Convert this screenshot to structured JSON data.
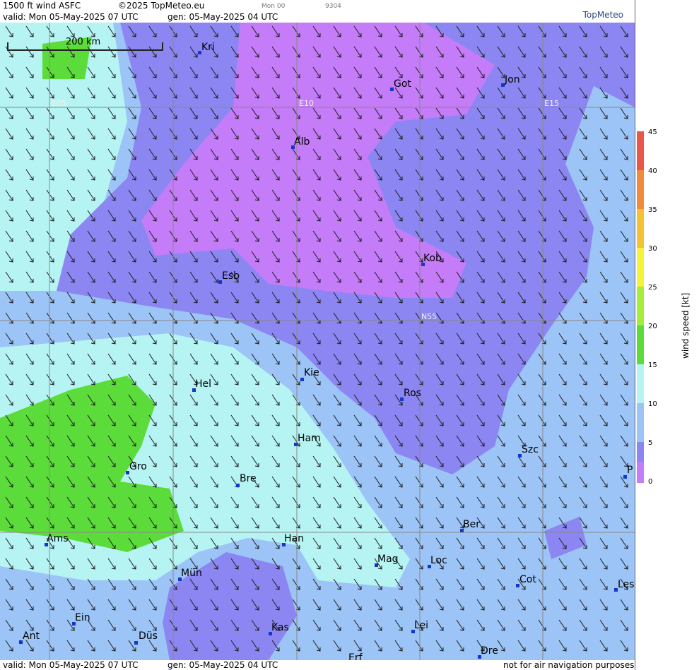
{
  "header": {
    "product": "1500 ft wind ASFC",
    "copyright": "©2025 TopMeteo.eu",
    "valid": "valid:  Mon  05-May-2025  07 UTC",
    "gen": "gen: 05-May-2025 04 UTC",
    "small_a": "Mon 00",
    "small_b": "9304",
    "logo": "TopMeteo"
  },
  "footer": {
    "valid": "valid:  Mon  05-May-2025  07 UTC",
    "gen": "gen: 05-May-2025 04 UTC",
    "note": "not for air navigation purposes"
  },
  "scale": {
    "label": "200 km"
  },
  "grid_labels": [
    "E05",
    "E10",
    "E15",
    "N55"
  ],
  "cities": [
    "Kri",
    "Got",
    "Jon",
    "Alb",
    "Kob",
    "Esb",
    "Kie",
    "Hel",
    "Ros",
    "Ham",
    "Szc",
    "Gro",
    "Bre",
    "P",
    "Ber",
    "Han",
    "Ams",
    "Mag",
    "Loc",
    "Mün",
    "Cot",
    "Les",
    "Ein",
    "Lei",
    "Kas",
    "Ant",
    "Düs",
    "Dre",
    "Erf"
  ],
  "legend": {
    "title": "wind speed [kt]",
    "ticks": [
      "45",
      "40",
      "35",
      "30",
      "25",
      "20",
      "15",
      "10",
      "5",
      "0"
    ],
    "colors": [
      "#e8574a",
      "#f08a3c",
      "#f5c233",
      "#f5f23a",
      "#a6ec3a",
      "#5bdc3a",
      "#b6f4f4",
      "#9cc4f6",
      "#8c86f2",
      "#c47cf8"
    ]
  }
}
